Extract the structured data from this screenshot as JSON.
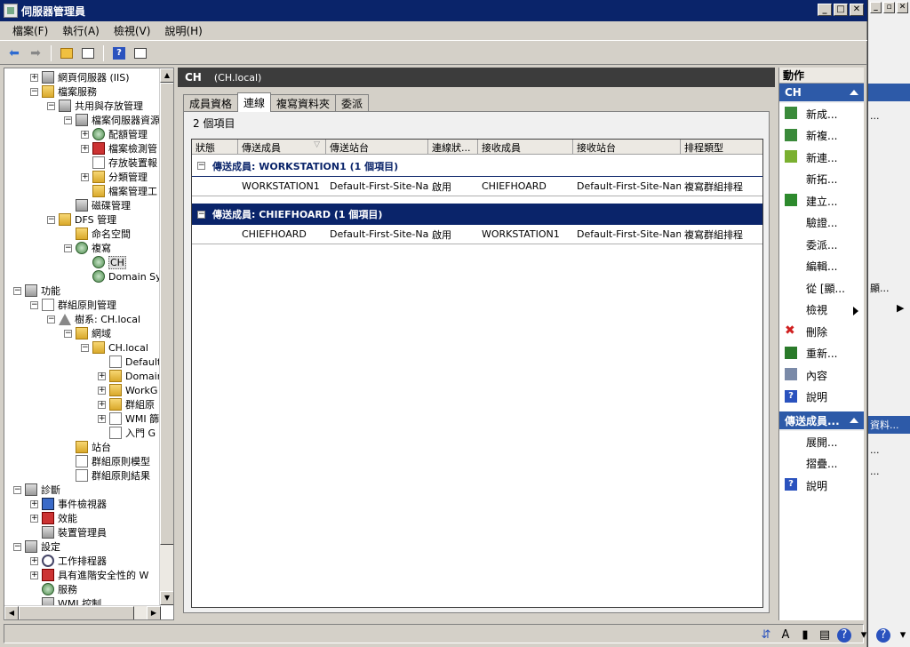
{
  "window": {
    "title": "伺服器管理員",
    "buttons": [
      "_",
      "□",
      "✕"
    ]
  },
  "menu": [
    "檔案(F)",
    "執行(A)",
    "檢視(V)",
    "說明(H)"
  ],
  "tree": {
    "nodes": [
      {
        "label": "網頁伺服器 (IIS)",
        "exp": "+"
      },
      {
        "label": "檔案服務",
        "exp": "−"
      },
      {
        "label": "共用與存放管理",
        "exp": "−"
      },
      {
        "label": "檔案伺服器資源",
        "exp": "−"
      },
      {
        "label": "配額管理",
        "exp": "+"
      },
      {
        "label": "檔案檢測管",
        "exp": "+"
      },
      {
        "label": "存放裝置報",
        "exp": ""
      },
      {
        "label": "分類管理",
        "exp": "+"
      },
      {
        "label": "檔案管理工",
        "exp": ""
      },
      {
        "label": "磁碟管理",
        "exp": ""
      },
      {
        "label": "DFS 管理",
        "exp": "−"
      },
      {
        "label": "命名空間",
        "exp": ""
      },
      {
        "label": "複寫",
        "exp": "−"
      },
      {
        "label": "CH",
        "exp": ""
      },
      {
        "label": "Domain Sys",
        "exp": ""
      },
      {
        "label": "功能",
        "exp": "−"
      },
      {
        "label": "群組原則管理",
        "exp": "−"
      },
      {
        "label": "樹系: CH.local",
        "exp": "−"
      },
      {
        "label": "網域",
        "exp": "−"
      },
      {
        "label": "CH.local",
        "exp": "−"
      },
      {
        "label": "Default",
        "exp": ""
      },
      {
        "label": "Domain",
        "exp": "+"
      },
      {
        "label": "WorkG",
        "exp": "+"
      },
      {
        "label": "群組原",
        "exp": "+"
      },
      {
        "label": "WMI 篩",
        "exp": "+"
      },
      {
        "label": "入門 G",
        "exp": ""
      },
      {
        "label": "站台",
        "exp": ""
      },
      {
        "label": "群組原則模型",
        "exp": ""
      },
      {
        "label": "群組原則結果",
        "exp": ""
      },
      {
        "label": "診斷",
        "exp": "−"
      },
      {
        "label": "事件檢視器",
        "exp": "+"
      },
      {
        "label": "效能",
        "exp": "+"
      },
      {
        "label": "裝置管理員",
        "exp": ""
      },
      {
        "label": "設定",
        "exp": "−"
      },
      {
        "label": "工作排程器",
        "exp": "+"
      },
      {
        "label": "具有進階安全性的 W",
        "exp": "+"
      },
      {
        "label": "服務",
        "exp": ""
      },
      {
        "label": "WMI 控制",
        "exp": ""
      }
    ]
  },
  "center": {
    "header_title": "CH",
    "header_sub": "(CH.local)",
    "tabs": [
      "成員資格",
      "連線",
      "複寫資料夾",
      "委派"
    ],
    "count": "2 個項目",
    "columns": [
      "狀態",
      "傳送成員",
      "傳送站台",
      "連線狀...",
      "接收成員",
      "接收站台",
      "排程類型"
    ],
    "groups": [
      {
        "title": "傳送成員: WORKSTATION1 (1 個項目)",
        "row": [
          "",
          "WORKSTATION1",
          "Default-First-Site-Na...",
          "啟用",
          "CHIEFHOARD",
          "Default-First-Site-Name",
          "複寫群組排程"
        ]
      },
      {
        "title": "傳送成員: CHIEFHOARD (1 個項目)",
        "row": [
          "",
          "CHIEFHOARD",
          "Default-First-Site-Na...",
          "啟用",
          "WORKSTATION1",
          "Default-First-Site-Name",
          "複寫群組排程"
        ]
      }
    ]
  },
  "actions": {
    "title": "動作",
    "section1": "CH",
    "items1": [
      "新成...",
      "新複...",
      "新連...",
      "新拓...",
      "建立...",
      "驗證...",
      "委派...",
      "編輯...",
      "從 [顯...",
      "檢視",
      "刪除",
      "重新...",
      "內容",
      "說明"
    ],
    "section2": "傳送成員...",
    "items2": [
      "展開...",
      "摺疊...",
      "說明"
    ]
  },
  "bg": {
    "labels": [
      "...",
      "顯...",
      "▶",
      "...",
      "...",
      "...",
      "...",
      "...",
      "資料..."
    ]
  }
}
